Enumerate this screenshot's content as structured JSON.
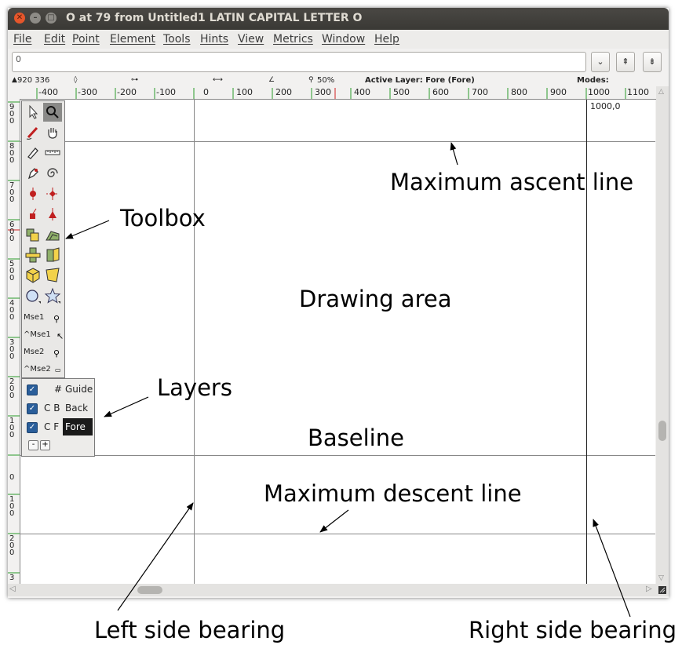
{
  "window": {
    "title": "O at 79 from Untitled1 LATIN CAPITAL LETTER O",
    "close_glyph": "✕",
    "min_glyph": "–",
    "max_glyph": "□"
  },
  "menubar": {
    "items": [
      "File",
      "Edit",
      "Point",
      "Element",
      "Tools",
      "Hints",
      "View",
      "Metrics",
      "Window",
      "Help"
    ]
  },
  "glyph_input": {
    "value": "0"
  },
  "search_buttons": {
    "dropdown": "⌄",
    "prev": "⇞",
    "next": "⇟"
  },
  "infobar": {
    "pointer": "920 336",
    "zoom": "50%",
    "active_layer": "Active Layer: Fore (Fore)",
    "modes": "Modes:"
  },
  "hruler": {
    "labels": [
      "-400",
      "-300",
      "-200",
      "-100",
      "0",
      "100",
      "200",
      "300",
      "400",
      "500",
      "600",
      "700",
      "800",
      "900",
      "1000",
      "1100"
    ]
  },
  "vruler": {
    "labels": [
      "900",
      "800",
      "700",
      "600",
      "500",
      "400",
      "300",
      "200",
      "100",
      "0",
      "100",
      "200",
      "3"
    ]
  },
  "canvas": {
    "point_label": "1000,0"
  },
  "toolbox": {
    "mse1": "Mse1",
    "mse1_ctrl": "^Mse1",
    "mse2": "Mse2",
    "mse2_ctrl": "^Mse2"
  },
  "layers": {
    "items": [
      {
        "prefix": "#",
        "name": "Guide"
      },
      {
        "prefix": "C B",
        "name": "Back"
      },
      {
        "prefix": "C F",
        "name": "Fore"
      }
    ],
    "minus": "-",
    "plus": "+"
  },
  "annotations": {
    "max_ascent": "Maximum ascent line",
    "toolbox": "Toolbox",
    "drawing_area": "Drawing area",
    "layers": "Layers",
    "baseline": "Baseline",
    "max_descent": "Maximum descent line",
    "left_bearing": "Left side bearing",
    "right_bearing": "Right side bearing"
  },
  "colors": {
    "titlebar": "#3c3b37",
    "close_button": "#e5562b",
    "selected_layer": "#1a1a1a",
    "checkbox": "#2a5e9a",
    "ruler_green": "#2a9a2a",
    "ruler_red": "#d02020"
  }
}
